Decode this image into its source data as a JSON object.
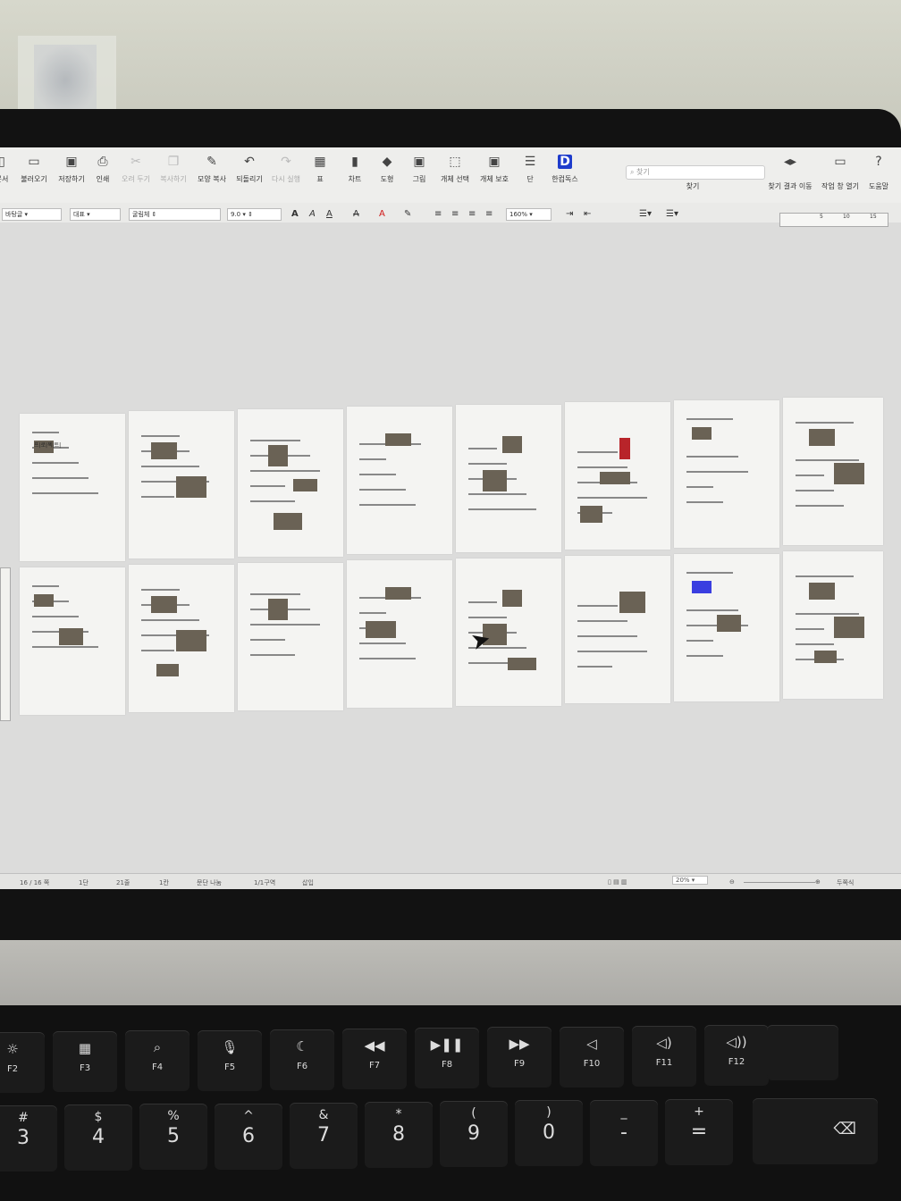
{
  "toolbar": {
    "items": [
      {
        "label": "문서",
        "icon": "document-icon"
      },
      {
        "label": "불러오기",
        "icon": "folder-icon"
      },
      {
        "label": "저장하기",
        "icon": "save-icon"
      },
      {
        "label": "인쇄",
        "icon": "print-icon"
      },
      {
        "label": "오려 두기",
        "icon": "scissors-icon"
      },
      {
        "label": "복사하기",
        "icon": "copy-icon"
      },
      {
        "label": "모양 복사",
        "icon": "format-copy-icon"
      },
      {
        "label": "되돌리기",
        "icon": "undo-icon"
      },
      {
        "label": "다시 실행",
        "icon": "redo-icon"
      },
      {
        "label": "표",
        "icon": "table-icon"
      },
      {
        "label": "차트",
        "icon": "chart-icon"
      },
      {
        "label": "도형",
        "icon": "shape-icon"
      },
      {
        "label": "그림",
        "icon": "picture-icon"
      },
      {
        "label": "개체 선택",
        "icon": "select-object-icon"
      },
      {
        "label": "개체 보호",
        "icon": "protect-object-icon"
      },
      {
        "label": "단",
        "icon": "columns-icon"
      },
      {
        "label": "한컴독스",
        "icon": "hancom-docs-icon"
      },
      {
        "label": "찾기",
        "icon": "find-icon"
      },
      {
        "label": "찾기 결과 이동",
        "icon": "find-nav-icon"
      },
      {
        "label": "작업 창 열기",
        "icon": "task-pane-icon"
      },
      {
        "label": "도움말",
        "icon": "help-icon"
      }
    ],
    "search_placeholder": "찾기",
    "hancom_letter": "D"
  },
  "format": {
    "style": "바탕글",
    "lang": "대표",
    "font": "굴림체",
    "size": "9.0",
    "zoom": "160%",
    "bold_glyph": "A",
    "italic_glyph": "A",
    "underline_glyph": "A",
    "strike_glyph": "A",
    "color_glyph": "A",
    "ruler_ticks": [
      "5",
      "10",
      "15"
    ]
  },
  "status": {
    "page": "16 / 16 쪽",
    "column": "1단",
    "line": "21줄",
    "col": "1칸",
    "break": "문단 나눔",
    "section": "1/1구역",
    "mode": "삽입",
    "zoom": "20%",
    "view": "두쪽식"
  },
  "pages": {
    "total": 16,
    "rows": 2,
    "per_row": 8,
    "title_text": "프|로|젝|트|"
  },
  "keyboard": {
    "fkeys": [
      {
        "glyph": "☼",
        "label": "F2"
      },
      {
        "glyph": "▦",
        "label": "F3"
      },
      {
        "glyph": "⌕",
        "label": "F4"
      },
      {
        "glyph": "🎙",
        "label": "F5"
      },
      {
        "glyph": "☾",
        "label": "F6"
      },
      {
        "glyph": "◀◀",
        "label": "F7"
      },
      {
        "glyph": "▶❚❚",
        "label": "F8"
      },
      {
        "glyph": "▶▶",
        "label": "F9"
      },
      {
        "glyph": "◁",
        "label": "F10"
      },
      {
        "glyph": "◁)",
        "label": "F11"
      },
      {
        "glyph": "◁))",
        "label": "F12"
      }
    ],
    "numkeys": [
      {
        "top": "#",
        "bottom": "3"
      },
      {
        "top": "$",
        "bottom": "4"
      },
      {
        "top": "%",
        "bottom": "5"
      },
      {
        "top": "^",
        "bottom": "6"
      },
      {
        "top": "&",
        "bottom": "7"
      },
      {
        "top": "*",
        "bottom": "8"
      },
      {
        "top": "(",
        "bottom": "9"
      },
      {
        "top": ")",
        "bottom": "0"
      },
      {
        "top": "_",
        "bottom": "-"
      },
      {
        "top": "+",
        "bottom": "="
      }
    ],
    "delete_glyph": "⌫"
  }
}
